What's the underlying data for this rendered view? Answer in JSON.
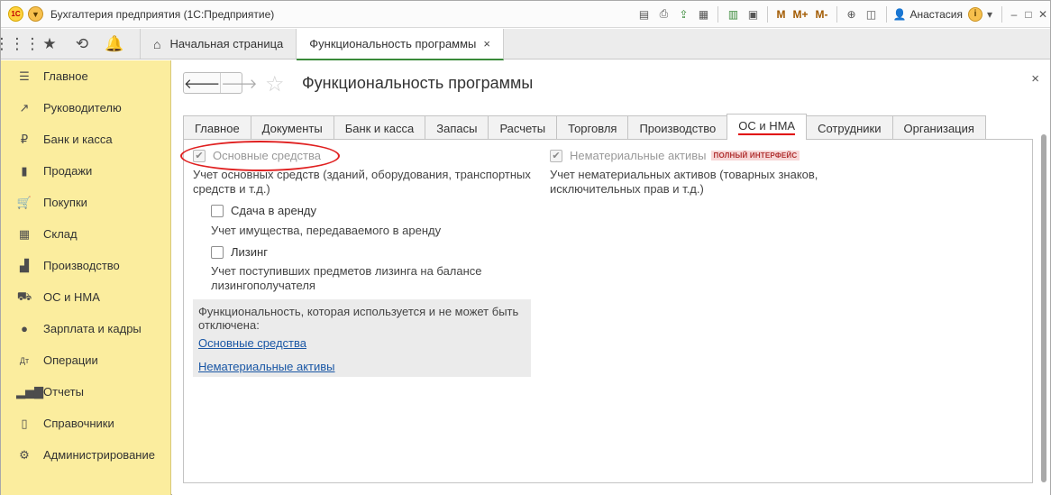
{
  "titlebar": {
    "app_title": "Бухгалтерия предприятия  (1С:Предприятие)",
    "logo": "1С",
    "user": "Анастасия",
    "m_labels": [
      "M",
      "M+",
      "M-"
    ]
  },
  "open_tabs": [
    {
      "label": "Начальная страница",
      "icon": "home-icon"
    },
    {
      "label": "Функциональность программы",
      "active": true,
      "close": "×"
    }
  ],
  "sidebar": {
    "items": [
      {
        "label": "Главное",
        "icon": "menu-lines-icon"
      },
      {
        "label": "Руководителю",
        "icon": "trend-icon"
      },
      {
        "label": "Банк и касса",
        "icon": "ruble-icon"
      },
      {
        "label": "Продажи",
        "icon": "bag-icon"
      },
      {
        "label": "Покупки",
        "icon": "cart-icon"
      },
      {
        "label": "Склад",
        "icon": "grid-icon"
      },
      {
        "label": "Производство",
        "icon": "factory-icon"
      },
      {
        "label": "ОС и НМА",
        "icon": "truck-icon"
      },
      {
        "label": "Зарплата и кадры",
        "icon": "person-icon"
      },
      {
        "label": "Операции",
        "icon": "dt-kt-icon"
      },
      {
        "label": "Отчеты",
        "icon": "bar-chart-icon"
      },
      {
        "label": "Справочники",
        "icon": "book-icon"
      },
      {
        "label": "Администрирование",
        "icon": "gear-icon"
      }
    ]
  },
  "main": {
    "title": "Функциональность программы",
    "close": "×",
    "tabs": [
      "Главное",
      "Документы",
      "Банк и касса",
      "Запасы",
      "Расчеты",
      "Торговля",
      "Производство",
      "ОС и НМА",
      "Сотрудники",
      "Организация"
    ],
    "active_tab": "ОС и НМА",
    "left": {
      "fixed_assets_label": "Основные средства",
      "fixed_assets_desc_1": "Учет основных средств (зданий, оборудования, транспортных",
      "fixed_assets_desc_2": "средств и т.д.)",
      "lease_label": "Сдача в аренду",
      "lease_desc": "Учет имущества, передаваемого в аренду",
      "leasing_label": "Лизинг",
      "leasing_desc_1": "Учет поступивших предметов лизинга на балансе",
      "leasing_desc_2": "лизингополучателя"
    },
    "right": {
      "intangible_label": "Нематериальные активы",
      "badge": "ПОЛНЫЙ ИНТЕРФЕЙС",
      "intangible_desc_1": "Учет нематериальных активов (товарных знаков,",
      "intangible_desc_2": "исключительных прав и т.д.)"
    },
    "info_box": {
      "text_1": "Функциональность, которая используется и не может быть",
      "text_2": "отключена:",
      "link_1": "Основные средства",
      "link_2": "Нематериальные активы"
    }
  }
}
